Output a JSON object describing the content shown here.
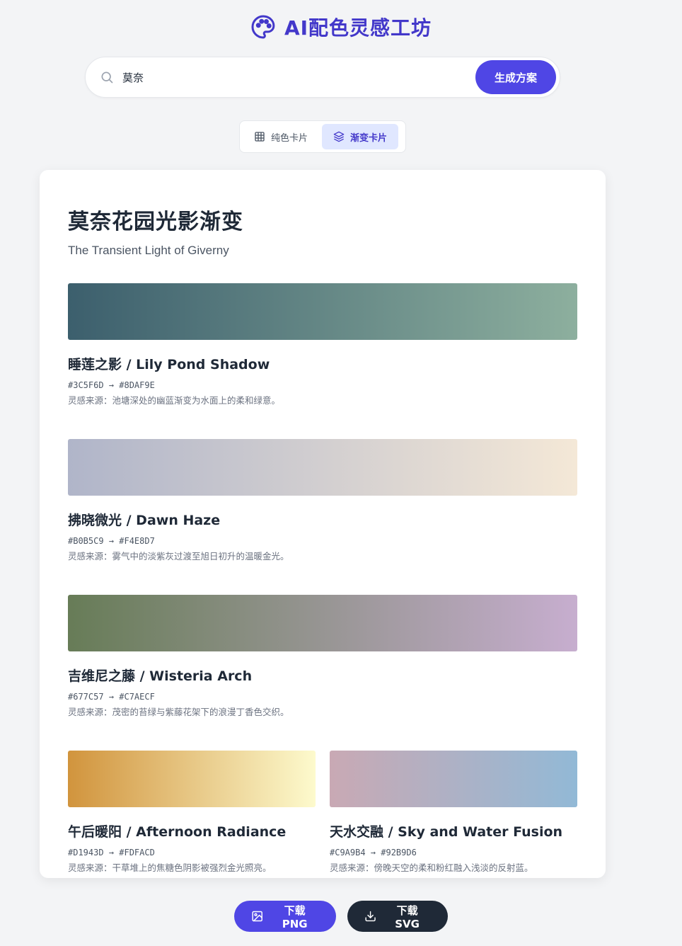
{
  "header": {
    "title": "AI配色灵感工坊",
    "logo_icon": "palette-icon",
    "accent": "#4338ca"
  },
  "search": {
    "value": "莫奈",
    "placeholder": "",
    "button_label": "生成方案",
    "icon": "search-icon"
  },
  "tabs": [
    {
      "label": "纯色卡片",
      "icon": "grid-icon",
      "active": false
    },
    {
      "label": "渐变卡片",
      "icon": "layers-icon",
      "active": true
    }
  ],
  "card": {
    "title": "莫奈花园光影渐变",
    "subtitle": "The Transient Light of Giverny",
    "swatches": [
      {
        "name": "睡莲之影 / Lily Pond Shadow",
        "from": "#3C5F6D",
        "to": "#8DAF9E",
        "codes": "#3C5F6D → #8DAF9E",
        "desc": "灵感来源：池塘深处的幽蓝渐变为水面上的柔和绿意。"
      },
      {
        "name": "拂晓微光 / Dawn Haze",
        "from": "#B0B5C9",
        "to": "#F4E8D7",
        "codes": "#B0B5C9 → #F4E8D7",
        "desc": "灵感来源：雾气中的淡紫灰过渡至旭日初升的温暖金光。"
      },
      {
        "name": "吉维尼之藤 / Wisteria Arch",
        "from": "#677C57",
        "to": "#C7AECF",
        "codes": "#677C57 → #C7AECF",
        "desc": "灵感来源：茂密的苔绿与紫藤花架下的浪漫丁香色交织。"
      },
      {
        "name": "午后暖阳 / Afternoon Radiance",
        "from": "#D1943D",
        "to": "#FDFACD",
        "codes": "#D1943D → #FDFACD",
        "desc": "灵感来源：干草堆上的焦糖色阴影被强烈金光照亮。"
      },
      {
        "name": "天水交融 / Sky and Water Fusion",
        "from": "#C9A9B4",
        "to": "#92B9D6",
        "codes": "#C9A9B4 → #92B9D6",
        "desc": "灵感来源：傍晚天空的柔和粉红融入浅淡的反射蓝。"
      }
    ]
  },
  "downloads": {
    "png_label": "下载 PNG",
    "svg_label": "下载 SVG",
    "png_icon": "image-icon",
    "svg_icon": "download-icon"
  }
}
